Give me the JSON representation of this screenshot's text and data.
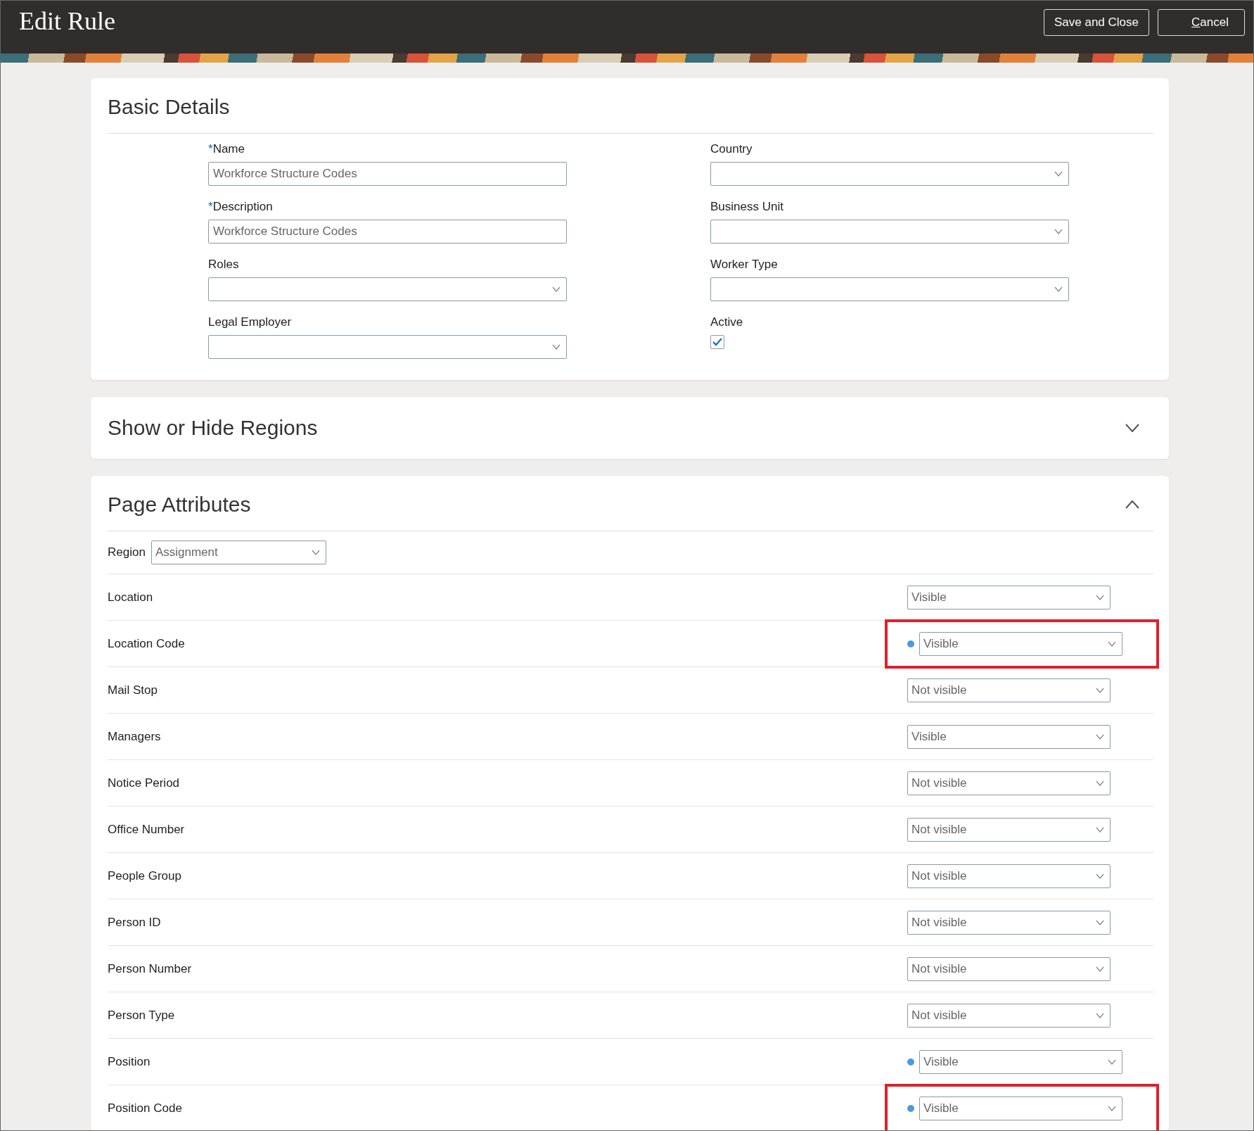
{
  "header": {
    "title": "Edit Rule",
    "buttons": [
      {
        "label": "Save and Close",
        "kind": "primary"
      },
      {
        "label": "Cancel",
        "kind": "secondary"
      }
    ]
  },
  "basic_details": {
    "title": "Basic Details",
    "left_fields": [
      {
        "label": "Name",
        "required_mark": "*",
        "kind": "text",
        "value": "Workforce Structure Codes"
      },
      {
        "label": "Description",
        "required_mark": "*",
        "kind": "text",
        "value": "Workforce Structure Codes"
      },
      {
        "label": "Roles",
        "kind": "select"
      },
      {
        "label": "Legal Employer",
        "kind": "select"
      }
    ],
    "right_fields": [
      {
        "label": "Country",
        "kind": "select"
      },
      {
        "label": "Business Unit",
        "kind": "select"
      },
      {
        "label": "Worker Type",
        "kind": "select"
      },
      {
        "label": "Active",
        "kind": "checkbox",
        "checked": true
      }
    ]
  },
  "show_hide_regions": {
    "title": "Show or Hide Regions",
    "expanded": false
  },
  "page_attributes": {
    "title": "Page Attributes",
    "expanded": true,
    "region": {
      "label": "Region",
      "value": "Assignment"
    },
    "rows": [
      {
        "label": "Location",
        "value": "Visible",
        "changed": false,
        "highlighted": false
      },
      {
        "label": "Location Code",
        "value": "Visible",
        "changed": true,
        "highlighted": true
      },
      {
        "label": "Mail Stop",
        "value": "Not visible",
        "changed": false,
        "highlighted": false
      },
      {
        "label": "Managers",
        "value": "Visible",
        "changed": false,
        "highlighted": false
      },
      {
        "label": "Notice Period",
        "value": "Not visible",
        "changed": false,
        "highlighted": false
      },
      {
        "label": "Office Number",
        "value": "Not visible",
        "changed": false,
        "highlighted": false
      },
      {
        "label": "People Group",
        "value": "Not visible",
        "changed": false,
        "highlighted": false
      },
      {
        "label": "Person ID",
        "value": "Not visible",
        "changed": false,
        "highlighted": false
      },
      {
        "label": "Person Number",
        "value": "Not visible",
        "changed": false,
        "highlighted": false
      },
      {
        "label": "Person Type",
        "value": "Not visible",
        "changed": false,
        "highlighted": false
      },
      {
        "label": "Position",
        "value": "Visible",
        "changed": true,
        "highlighted": false
      },
      {
        "label": "Position Code",
        "value": "Visible",
        "changed": true,
        "highlighted": true
      }
    ]
  }
}
